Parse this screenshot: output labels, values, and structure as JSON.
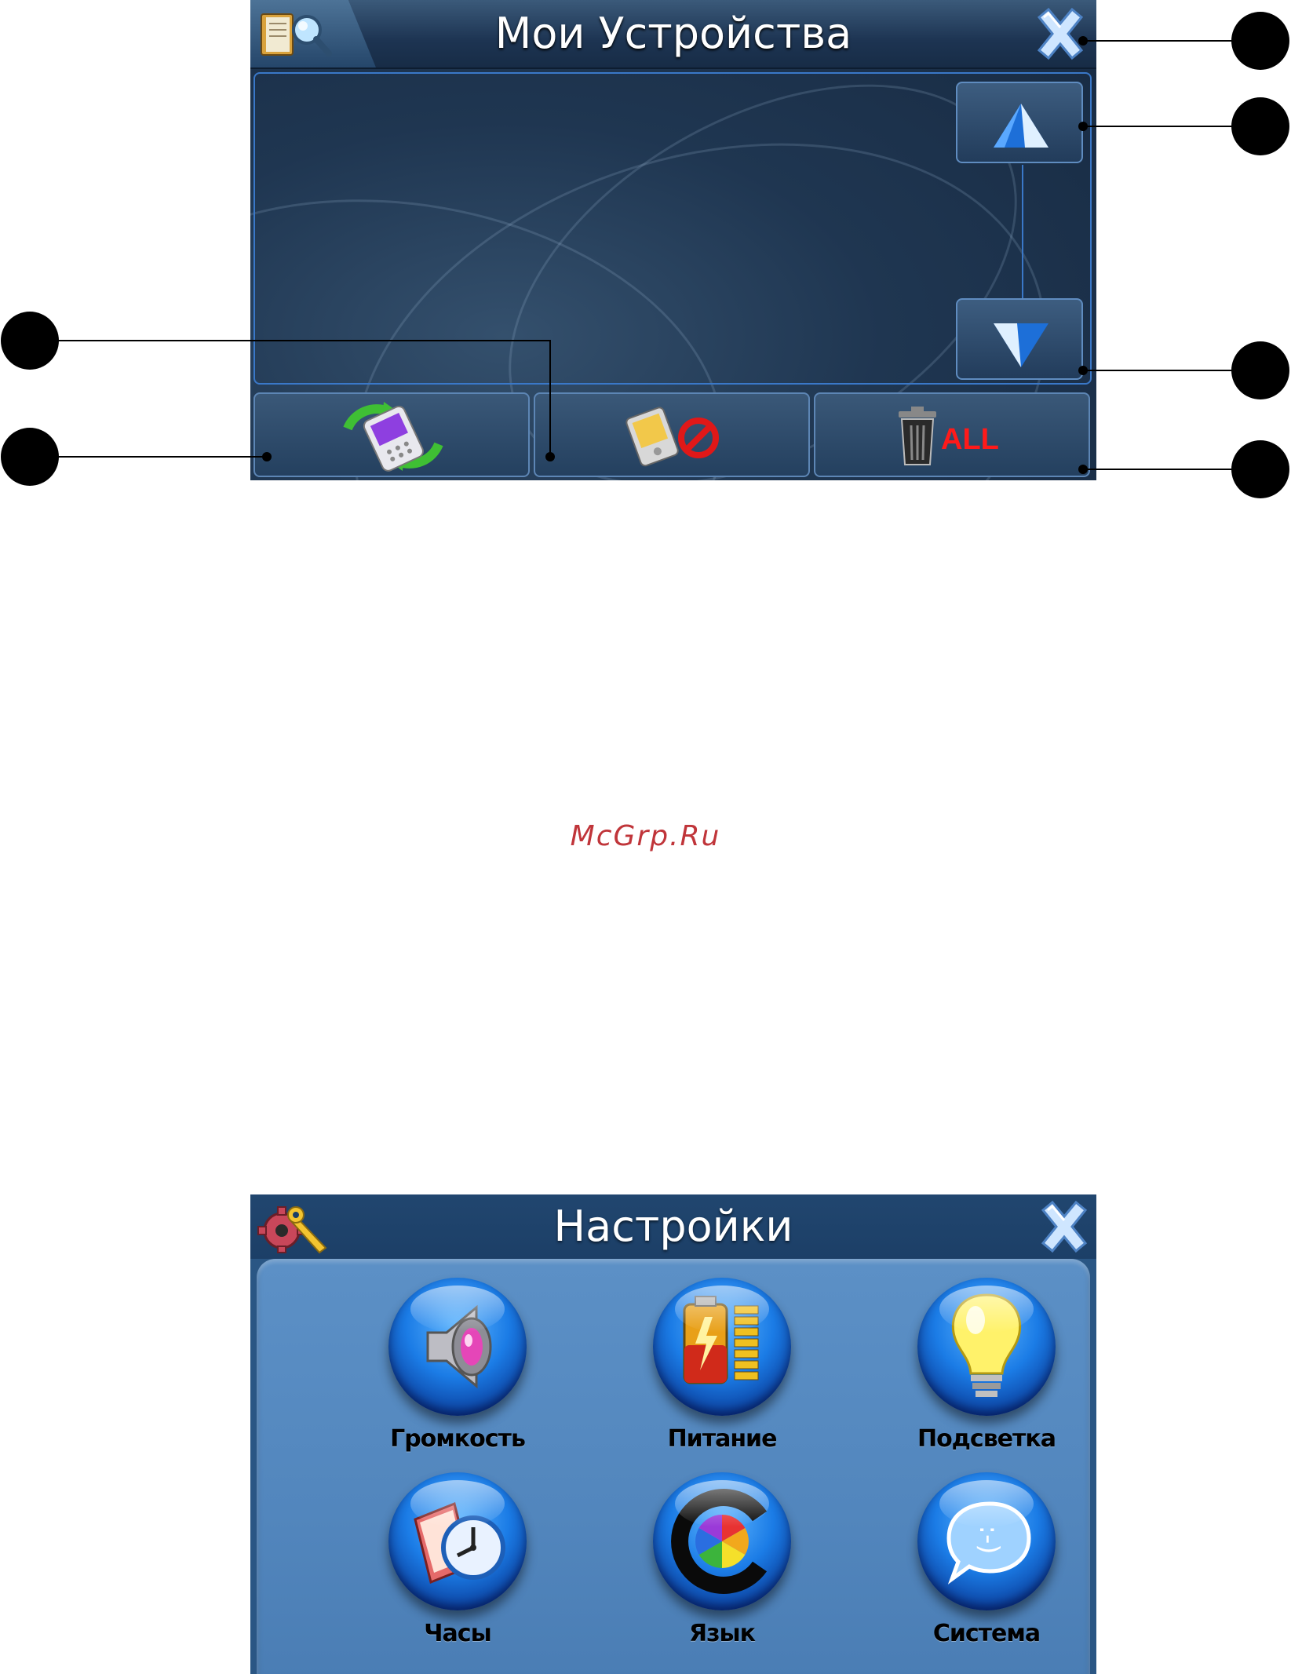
{
  "devices_screen": {
    "title": "Мои Устройства",
    "icons": {
      "app": "book-search-icon",
      "close": "close-icon",
      "scroll_up": "arrow-up-icon",
      "scroll_down": "arrow-down-icon",
      "sync": "phone-sync-icon",
      "disconnect": "pda-disconnect-icon",
      "delete_all": "trash-all-icon"
    },
    "delete_all_text": "ALL"
  },
  "watermark": "McGrp.Ru",
  "settings_screen": {
    "title": "Настройки",
    "icons": {
      "app": "gear-wrench-icon",
      "close": "close-icon"
    },
    "tiles": [
      {
        "label": "Громкость",
        "icon": "speaker-icon"
      },
      {
        "label": "Питание",
        "icon": "battery-icon"
      },
      {
        "label": "Подсветка",
        "icon": "lightbulb-icon"
      },
      {
        "label": "Часы",
        "icon": "clock-calendar-icon"
      },
      {
        "label": "Язык",
        "icon": "color-wheel-icon"
      },
      {
        "label": "Система",
        "icon": "chat-bubble-icon"
      }
    ]
  }
}
